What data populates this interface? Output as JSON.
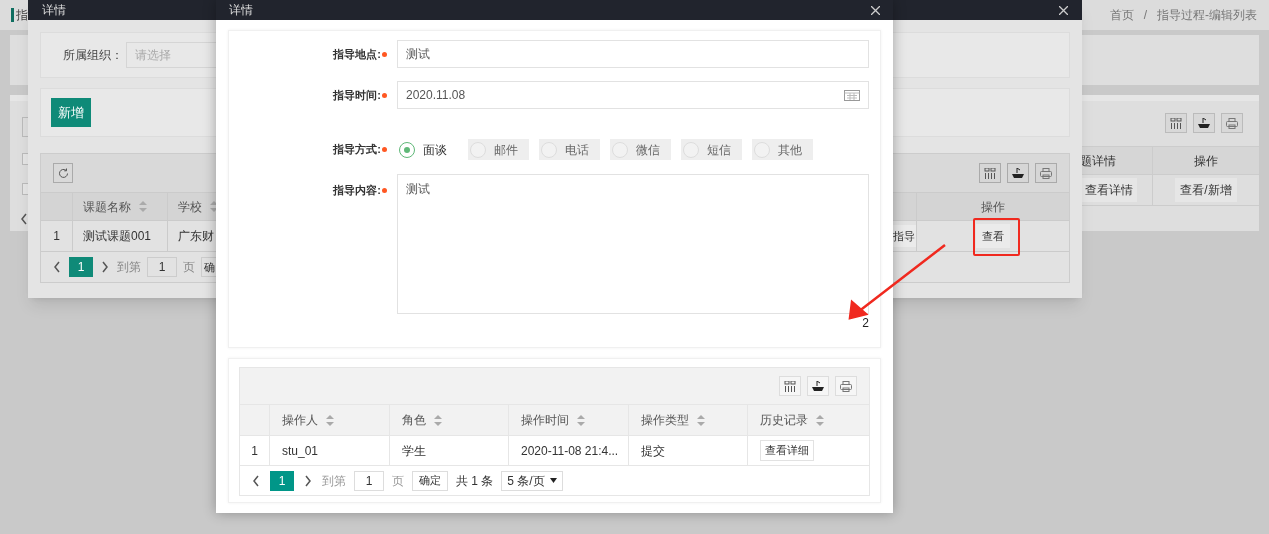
{
  "page": {
    "title_fragment": "指",
    "checkboxes": [
      {
        "checked": false
      },
      {
        "checked": false
      }
    ],
    "breadcrumb": {
      "items": [
        "首页",
        "指导过程-编辑列表"
      ],
      "separator": "/"
    },
    "table": {
      "columns": [
        "题详情",
        "操作"
      ],
      "rows": [
        {
          "detail_button": "查看详情",
          "action_button": "查看/新增"
        }
      ]
    }
  },
  "list_dialog": {
    "title": "详情",
    "filter": {
      "label": "所属组织：",
      "placeholder": "请选择"
    },
    "add_button": "新增",
    "table": {
      "columns": [
        "课题名称",
        "学校",
        "操作"
      ],
      "rows": [
        {
          "index": "1",
          "name": "测试课题001",
          "school": "广东财",
          "guide_button": "指导",
          "view_button": "查看"
        }
      ]
    },
    "pagination": {
      "current": "1",
      "goto_label": "到第",
      "page_value": "1",
      "page_label": "页",
      "confirm_button": "确"
    }
  },
  "detail_dialog": {
    "title": "详情",
    "fields": [
      {
        "kind": "text",
        "label": "指导地点:",
        "value": "测试"
      },
      {
        "kind": "date",
        "label": "指导时间:",
        "value": "2020.11.08"
      },
      {
        "kind": "radio",
        "label": "指导方式:",
        "options": [
          {
            "label": "面谈",
            "selected": true
          },
          {
            "label": "邮件",
            "selected": false
          },
          {
            "label": "电话",
            "selected": false
          },
          {
            "label": "微信",
            "selected": false
          },
          {
            "label": "短信",
            "selected": false
          },
          {
            "label": "其他",
            "selected": false
          }
        ]
      },
      {
        "kind": "textarea",
        "label": "指导内容:",
        "value": "测试"
      }
    ],
    "log_table": {
      "columns": [
        "操作人",
        "角色",
        "操作时间",
        "操作类型",
        "历史记录"
      ],
      "rows": [
        {
          "index": "1",
          "cells": [
            "stu_01",
            "学生",
            "2020-11-08 21:4...",
            "提交"
          ],
          "history_button": "查看详细"
        }
      ]
    },
    "pagination": {
      "current": "1",
      "goto_label": "到第",
      "page_value": "1",
      "page_label": "页",
      "confirm_button": "确定",
      "total": "共 1 条",
      "page_size": "5 条/页"
    }
  },
  "annotation": {
    "label": "2"
  }
}
